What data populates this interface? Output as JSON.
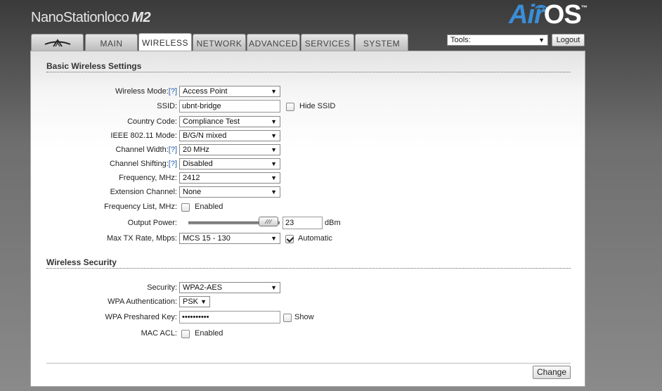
{
  "header": {
    "model_main": "NanoStation",
    "model_sub": "loco",
    "model_suffix": "M2",
    "brand_air": "Air",
    "brand_os": "OS",
    "brand_tm": "™"
  },
  "tabs": [
    {
      "label": "",
      "icon": "ubiquiti-logo-icon"
    },
    {
      "label": "MAIN"
    },
    {
      "label": "WIRELESS",
      "active": true
    },
    {
      "label": "NETWORK"
    },
    {
      "label": "ADVANCED"
    },
    {
      "label": "SERVICES"
    },
    {
      "label": "SYSTEM"
    }
  ],
  "toolbar": {
    "tools_value": "Tools:",
    "logout_label": "Logout"
  },
  "basic": {
    "title": "Basic Wireless Settings",
    "wireless_mode_label": "Wireless Mode:",
    "wireless_mode_value": "Access Point",
    "ssid_label": "SSID:",
    "ssid_value": "ubnt-bridge",
    "hide_ssid_label": "Hide SSID",
    "country_label": "Country Code:",
    "country_value": "Compliance Test",
    "ieee_label": "IEEE 802.11 Mode:",
    "ieee_value": "B/G/N mixed",
    "channel_width_label": "Channel Width:",
    "channel_width_value": "20 MHz",
    "channel_shift_label": "Channel Shifting:",
    "channel_shift_value": "Disabled",
    "frequency_label": "Frequency, MHz:",
    "frequency_value": "2412",
    "extension_label": "Extension Channel:",
    "extension_value": "None",
    "freq_list_label": "Frequency List, MHz:",
    "freq_list_enabled": "Enabled",
    "output_power_label": "Output Power:",
    "output_power_value": "23",
    "output_power_unit": "dBm",
    "max_tx_label": "Max TX Rate, Mbps:",
    "max_tx_value": "MCS 15 - 130",
    "automatic_label": "Automatic",
    "help": "[?]"
  },
  "security": {
    "title": "Wireless Security",
    "security_label": "Security:",
    "security_value": "WPA2-AES",
    "wpa_auth_label": "WPA Authentication:",
    "wpa_auth_value": "PSK",
    "psk_label": "WPA Preshared Key:",
    "psk_value": "••••••••••",
    "show_label": "Show",
    "mac_acl_label": "MAC ACL:",
    "mac_acl_enabled": "Enabled"
  },
  "actions": {
    "change_label": "Change"
  },
  "colors": {
    "brand_blue": "#3a8ed8",
    "help_link": "#1f5fa8"
  }
}
